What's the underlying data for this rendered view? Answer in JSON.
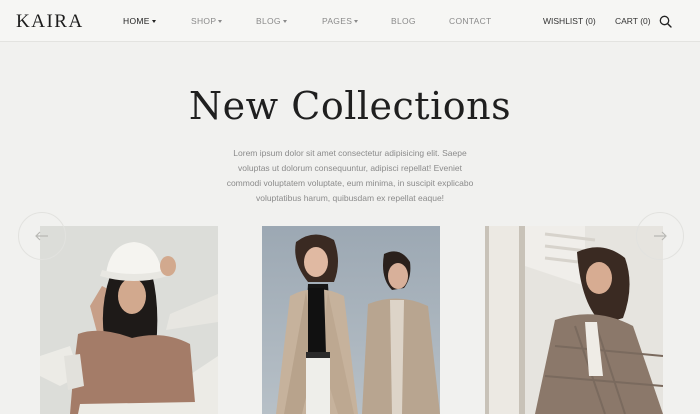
{
  "header": {
    "logo": "KAIRA",
    "nav": [
      {
        "label": "HOME",
        "dropdown": true,
        "active": true
      },
      {
        "label": "SHOP",
        "dropdown": true,
        "active": false
      },
      {
        "label": "BLOG",
        "dropdown": true,
        "active": false
      },
      {
        "label": "PAGES",
        "dropdown": true,
        "active": false
      },
      {
        "label": "BLOG",
        "dropdown": false,
        "active": false
      },
      {
        "label": "CONTACT",
        "dropdown": false,
        "active": false
      }
    ],
    "wishlist": "WISHLIST (0)",
    "cart": "CART (0)",
    "search_icon": "search-icon"
  },
  "hero": {
    "title": "New Collections",
    "description_lines": [
      "Lorem ipsum dolor sit amet consectetur adipisicing elit. Saepe",
      "voluptas ut dolorum consequuntur, adipisci repellat! Eveniet",
      "commodi voluptatem voluptate, eum minima, in suscipit explicabo",
      "voluptatibus harum, quibusdam ex repellat eaque!"
    ]
  },
  "carousel": {
    "prev_icon": "arrow-left-icon",
    "next_icon": "arrow-right-icon",
    "products": [
      {
        "image": "model-white-bucket-hat"
      },
      {
        "image": "two-models-beige-coats"
      },
      {
        "image": "model-plaid-coat"
      }
    ]
  },
  "colors": {
    "background": "#f1f1ef",
    "header_background": "#f6f6f4",
    "text_dark": "#1f1f1f",
    "text_muted": "#8b8b8b"
  }
}
